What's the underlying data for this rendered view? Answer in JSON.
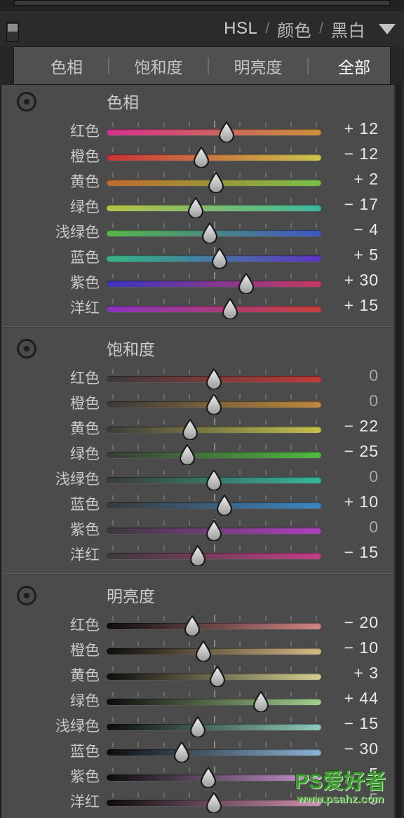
{
  "header": {
    "panel_toggle_icon": "panel-switch-icon",
    "segments": [
      "HSL",
      "颜色",
      "黑白"
    ],
    "separator": "/",
    "active_segment": "HSL",
    "caret_icon": "chevron-down-icon"
  },
  "tabs": [
    {
      "label": "色相",
      "active": false
    },
    {
      "label": "饱和度",
      "active": false
    },
    {
      "label": "明亮度",
      "active": false
    },
    {
      "label": "全部",
      "active": true
    }
  ],
  "tab_separator": "|",
  "sections": [
    {
      "title": "色相",
      "target_tool_icon": "target-adjustment-icon",
      "rows": [
        {
          "label": "红色",
          "value": "+ 12",
          "num": 12,
          "from": "#d4318d",
          "to": "#c8913a"
        },
        {
          "label": "橙色",
          "value": "− 12",
          "num": -12,
          "from": "#c8313a",
          "to": "#c9c64a"
        },
        {
          "label": "黄色",
          "value": "+ 2",
          "num": 2,
          "from": "#bf6a2e",
          "to": "#79c04a"
        },
        {
          "label": "绿色",
          "value": "− 17",
          "num": -17,
          "from": "#b9c146",
          "to": "#3cb89b"
        },
        {
          "label": "浅绿色",
          "value": "− 4",
          "num": -4,
          "from": "#59b648",
          "to": "#3f57c2"
        },
        {
          "label": "蓝色",
          "value": "+ 5",
          "num": 5,
          "from": "#33b883",
          "to": "#5c34c4"
        },
        {
          "label": "紫色",
          "value": "+ 30",
          "num": 30,
          "from": "#3a35c0",
          "to": "#c73b62"
        },
        {
          "label": "洋红",
          "value": "+ 15",
          "num": 15,
          "from": "#8a34c0",
          "to": "#c8413a"
        }
      ]
    },
    {
      "title": "饱和度",
      "target_tool_icon": "target-adjustment-icon",
      "rows": [
        {
          "label": "红色",
          "value": "0",
          "num": 0,
          "from": "#3a3a3a",
          "to": "#c23b3b"
        },
        {
          "label": "橙色",
          "value": "0",
          "num": 0,
          "from": "#3a3a3a",
          "to": "#c08a3e"
        },
        {
          "label": "黄色",
          "value": "− 22",
          "num": -22,
          "from": "#3a3a3a",
          "to": "#c5c24c"
        },
        {
          "label": "绿色",
          "value": "− 25",
          "num": -25,
          "from": "#3a3a3a",
          "to": "#4fba3f"
        },
        {
          "label": "浅绿色",
          "value": "0",
          "num": 0,
          "from": "#3a3a3a",
          "to": "#36b79a"
        },
        {
          "label": "蓝色",
          "value": "+ 10",
          "num": 10,
          "from": "#3a3a3a",
          "to": "#3c86c0"
        },
        {
          "label": "紫色",
          "value": "0",
          "num": 0,
          "from": "#3a3a3a",
          "to": "#b040c0"
        },
        {
          "label": "洋红",
          "value": "− 15",
          "num": -15,
          "from": "#3a3a3a",
          "to": "#c23f86"
        }
      ]
    },
    {
      "title": "明亮度",
      "target_tool_icon": "target-adjustment-icon",
      "rows": [
        {
          "label": "红色",
          "value": "− 20",
          "num": -20,
          "from": "#0c0c0c",
          "to": "#d08585"
        },
        {
          "label": "橙色",
          "value": "− 10",
          "num": -10,
          "from": "#0c0c0c",
          "to": "#d6bb87"
        },
        {
          "label": "黄色",
          "value": "+ 3",
          "num": 3,
          "from": "#0c0c0c",
          "to": "#d4cf91"
        },
        {
          "label": "绿色",
          "value": "+ 44",
          "num": 44,
          "from": "#0c0c0c",
          "to": "#a3cf8d"
        },
        {
          "label": "浅绿色",
          "value": "− 15",
          "num": -15,
          "from": "#0c0c0c",
          "to": "#8ecbbc"
        },
        {
          "label": "蓝色",
          "value": "− 30",
          "num": -30,
          "from": "#0c0c0c",
          "to": "#8cb4d6"
        },
        {
          "label": "紫色",
          "value": "− 5",
          "num": -5,
          "from": "#0c0c0c",
          "to": "#cb95d2"
        },
        {
          "label": "洋红",
          "value": "5",
          "num": 0,
          "from": "#0c0c0c",
          "to": "#cf8fb0"
        }
      ]
    }
  ],
  "watermark": {
    "line1": "PS爱好者",
    "line2": "www.psahz.com"
  },
  "colors": {
    "panel_bg": "#4b4b4b",
    "header_bg": "#2b2b2b",
    "tabbar_bg": "#505050",
    "text": "#c8c8c8",
    "active_text": "#fdfdfd"
  }
}
